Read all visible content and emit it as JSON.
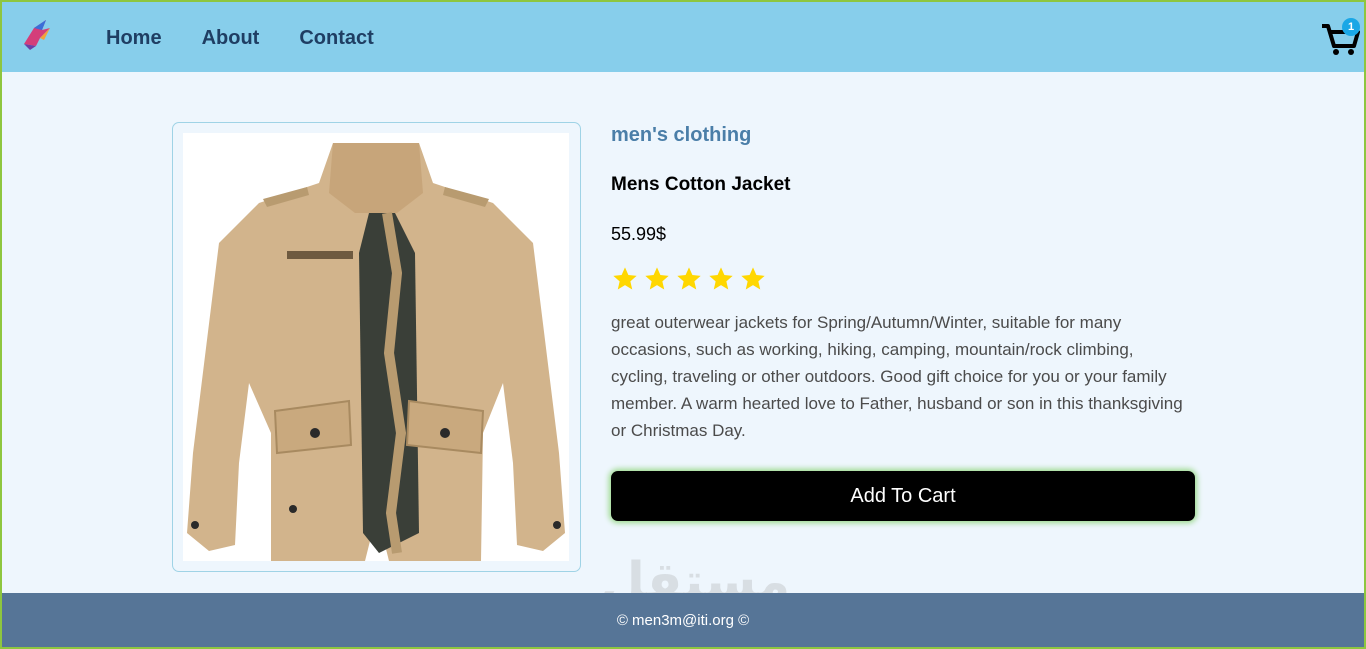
{
  "nav": {
    "links": [
      "Home",
      "About",
      "Contact"
    ],
    "cart_count": "1"
  },
  "product": {
    "category": "men's clothing",
    "title": "Mens Cotton Jacket",
    "price": "55.99$",
    "rating_stars": 5,
    "description": "great outerwear jackets for Spring/Autumn/Winter, suitable for many occasions, such as working, hiking, camping, mountain/rock climbing, cycling, traveling or other outdoors. Good gift choice for you or your family member. A warm hearted love to Father, husband or son in this thanksgiving or Christmas Day.",
    "add_to_cart_label": "Add To Cart"
  },
  "footer": {
    "text": "© men3m@iti.org ©"
  },
  "colors": {
    "navbar": "#87ceeb",
    "footer": "#567597",
    "star": "#ffd700",
    "button": "#000000"
  },
  "watermark": {
    "text": "مستقل"
  }
}
